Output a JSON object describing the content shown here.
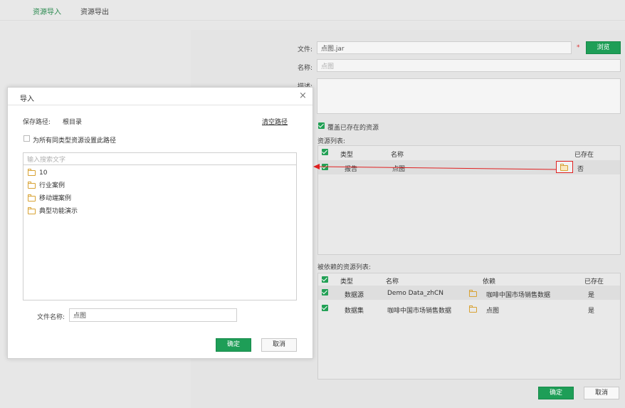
{
  "top_tabs": {
    "import": "资源导入",
    "export": "资源导出"
  },
  "form": {
    "file_label": "文件:",
    "file_value": "点图.jar",
    "browse": "浏览",
    "name_label": "名称:",
    "name_placeholder": "点图",
    "desc_label": "描述:",
    "overwrite": "覆盖已存在的资源",
    "resource_list_label": "资源列表:",
    "dep_list_label": "被依赖的资源列表:",
    "confirm": "确定",
    "cancel": "取消"
  },
  "resource_table": {
    "headers": {
      "type": "类型",
      "name": "名称",
      "exists": "已存在"
    },
    "rows": [
      {
        "type": "报告",
        "name": "点图",
        "exists": "否"
      }
    ]
  },
  "dep_table": {
    "headers": {
      "type": "类型",
      "name": "名称",
      "dep": "依赖",
      "exists": "已存在"
    },
    "rows": [
      {
        "type": "数据源",
        "name": "Demo Data_zhCN",
        "dep": "咖啡中国市场销售数据",
        "exists": "是"
      },
      {
        "type": "数据集",
        "name": "咖啡中国市场销售数据",
        "dep": "点图",
        "exists": "是"
      }
    ]
  },
  "dialog": {
    "title": "导入",
    "close": "×",
    "save_path_label": "保存路径:",
    "save_path_value": "根目录",
    "clear_path": "清空路径",
    "apply_all": "为所有同类型资源设置此路径",
    "search_placeholder": "输入搜索文字",
    "tree": [
      "10",
      "行业案例",
      "移动端案例",
      "典型功能演示"
    ],
    "filename_label": "文件名称:",
    "filename_value": "点图",
    "confirm": "确定",
    "cancel": "取消"
  },
  "colors": {
    "accent": "#1e9e57",
    "annotation": "#e02020"
  }
}
